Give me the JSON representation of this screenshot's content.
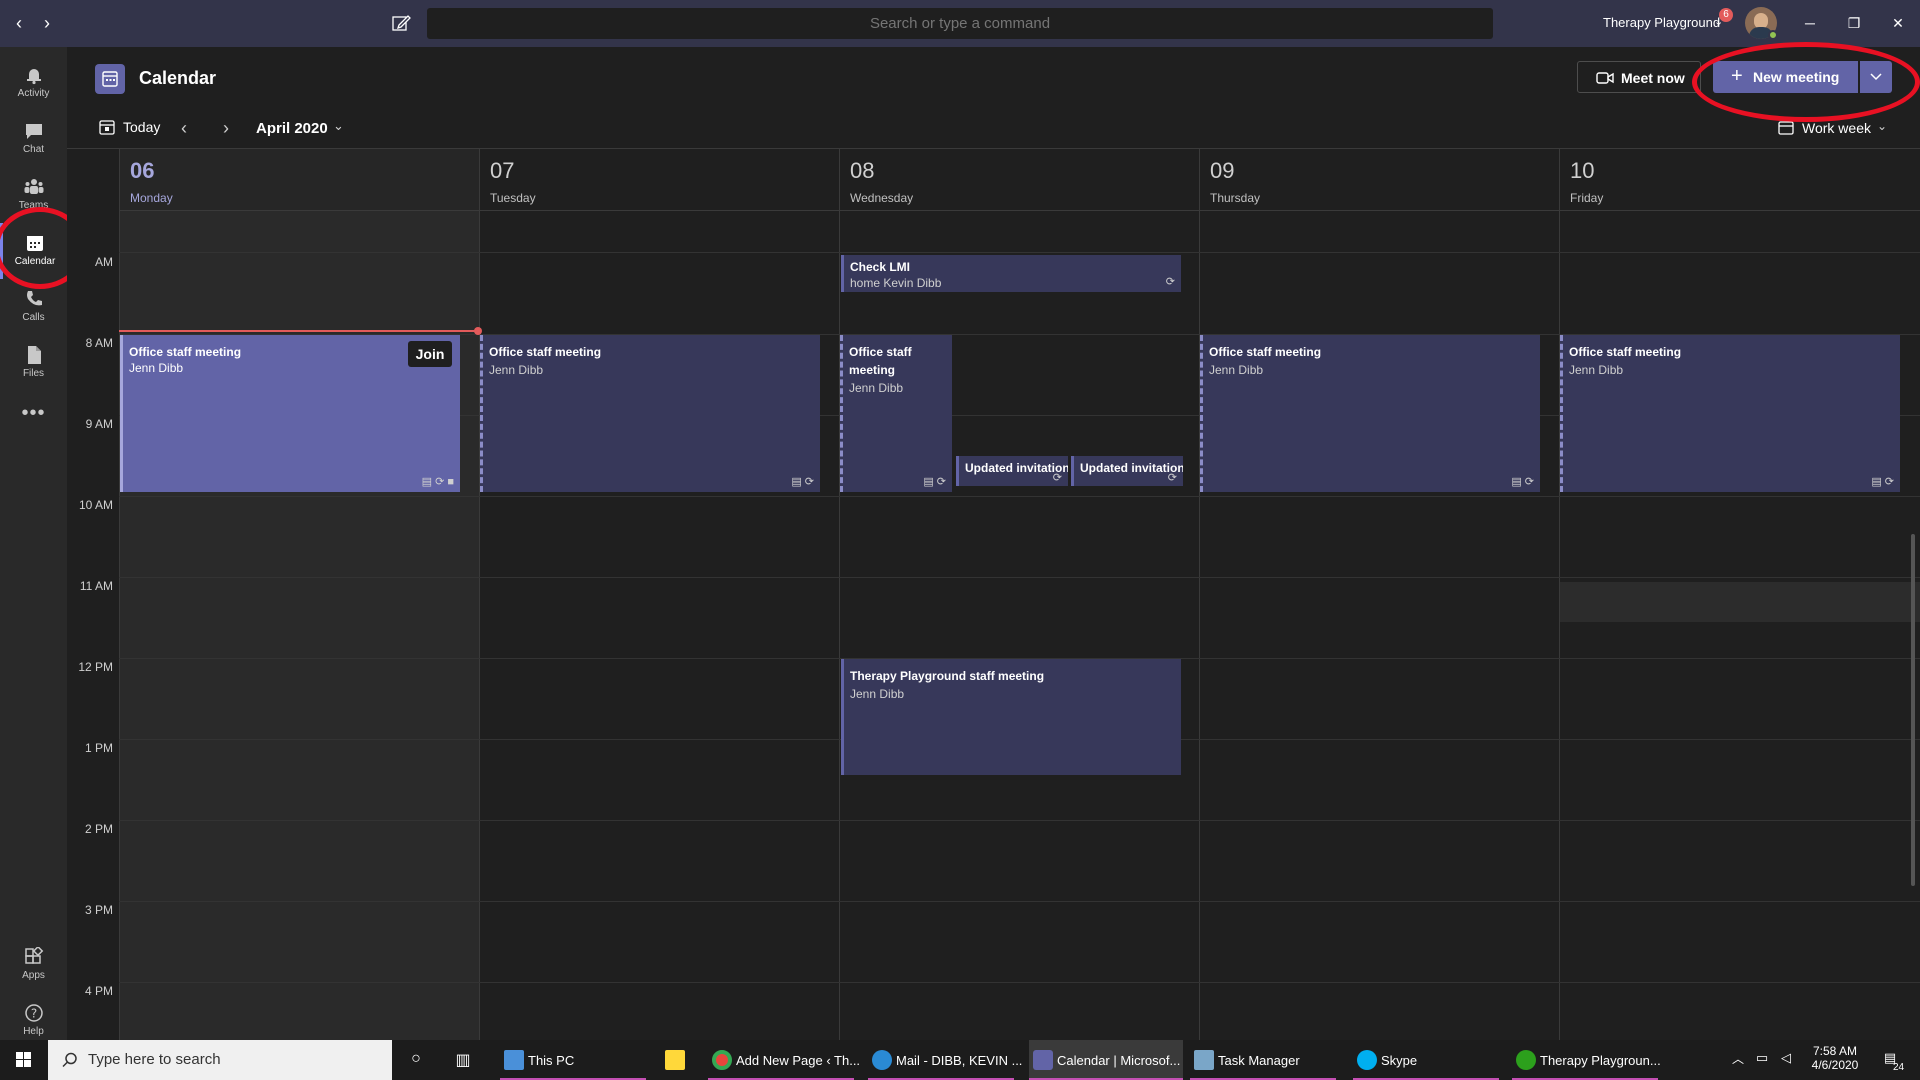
{
  "titlebar": {
    "search_placeholder": "Search or type a command",
    "org_name": "Therapy Playground",
    "notification_count": "6"
  },
  "rail": {
    "items": [
      {
        "label": "Activity",
        "icon": "bell-icon"
      },
      {
        "label": "Chat",
        "icon": "chat-icon"
      },
      {
        "label": "Teams",
        "icon": "teams-icon"
      },
      {
        "label": "Calendar",
        "icon": "calendar-icon"
      },
      {
        "label": "Calls",
        "icon": "phone-icon"
      },
      {
        "label": "Files",
        "icon": "file-icon"
      }
    ],
    "more": "•••",
    "apps_label": "Apps",
    "help_label": "Help"
  },
  "header": {
    "title": "Calendar",
    "meet_now": "Meet now",
    "new_meeting": "New meeting"
  },
  "toolbar": {
    "today": "Today",
    "month": "April 2020",
    "view": "Work week"
  },
  "days": [
    {
      "num": "06",
      "name": "Monday"
    },
    {
      "num": "07",
      "name": "Tuesday"
    },
    {
      "num": "08",
      "name": "Wednesday"
    },
    {
      "num": "09",
      "name": "Thursday"
    },
    {
      "num": "10",
      "name": "Friday"
    }
  ],
  "times": [
    "AM",
    "8 AM",
    "9 AM",
    "10 AM",
    "11 AM",
    "12 PM",
    "1 PM",
    "2 PM",
    "3 PM",
    "4 PM"
  ],
  "events": {
    "check_lmi": {
      "title": "Check LMI",
      "sub": "home  Kevin Dibb"
    },
    "mon_staff": {
      "title": "Office staff meeting",
      "sub": "Jenn Dibb",
      "join": "Join"
    },
    "tue_staff": {
      "title": "Office staff meeting",
      "sub": "Jenn Dibb"
    },
    "wed_staff": {
      "title": "Office staff meeting",
      "sub": "Jenn Dibb"
    },
    "wed_update1": {
      "title": "Updated invitation"
    },
    "wed_update2": {
      "title": "Updated invitation"
    },
    "thu_staff": {
      "title": "Office staff meeting",
      "sub": "Jenn Dibb"
    },
    "fri_staff": {
      "title": "Office staff meeting",
      "sub": "Jenn Dibb"
    },
    "tp_staff": {
      "title": "Therapy Playground staff meeting",
      "sub": "Jenn Dibb"
    }
  },
  "taskbar": {
    "search_placeholder": "Type here to search",
    "apps": [
      {
        "label": "This PC"
      },
      {
        "label": "Add New Page ‹ Th..."
      },
      {
        "label": "Mail - DIBB, KEVIN ..."
      },
      {
        "label": "Calendar | Microsof..."
      },
      {
        "label": "Task Manager"
      },
      {
        "label": "Skype"
      },
      {
        "label": "Therapy Playgroun..."
      }
    ],
    "time": "7:58 AM",
    "date": "4/6/2020",
    "notif_count": "24"
  },
  "colors": {
    "accent": "#6264a7",
    "titlebar": "#33344a",
    "highlight": "#e81123",
    "now_line": "#e35b5b"
  }
}
